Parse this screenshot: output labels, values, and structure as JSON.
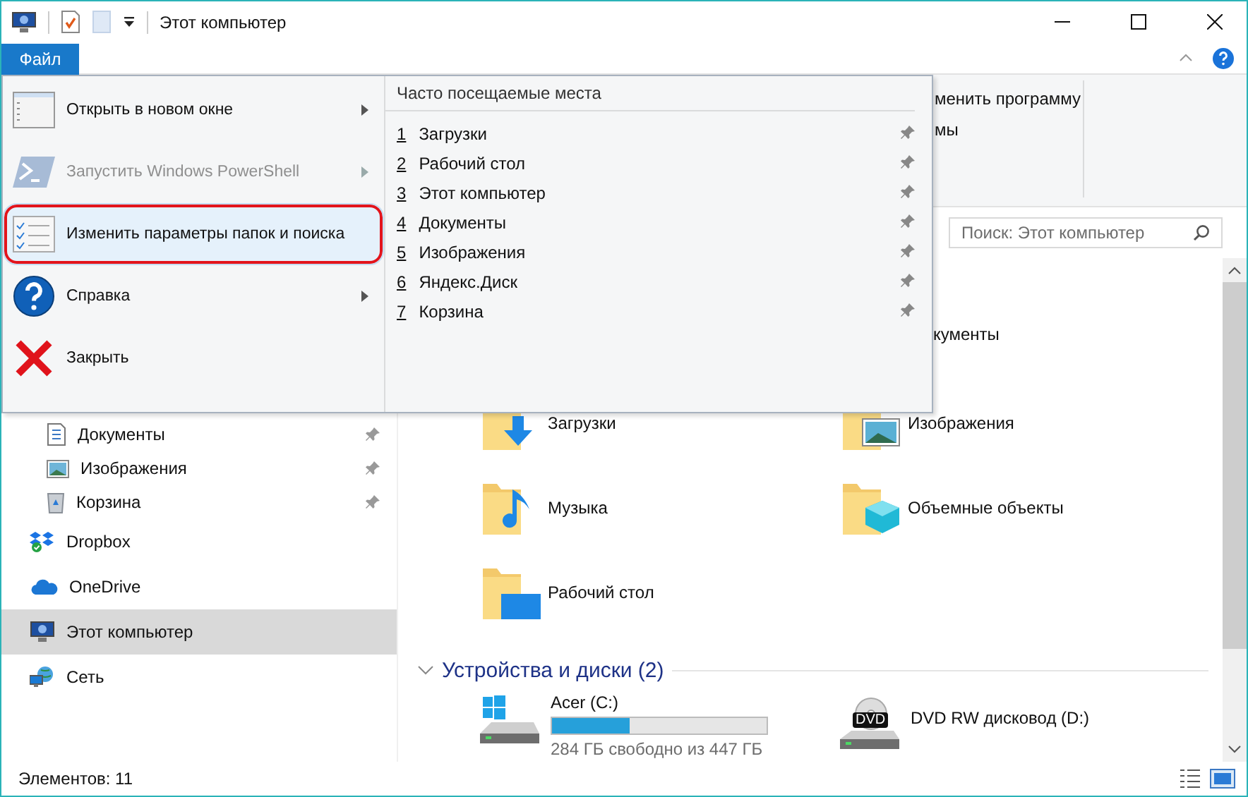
{
  "window": {
    "title": "Этот компьютер"
  },
  "file_tab": {
    "label": "Файл"
  },
  "file_menu": {
    "items": [
      {
        "label": "Открыть в новом окне",
        "kind": "window",
        "disabled": false,
        "submenu": true,
        "highlighted": false
      },
      {
        "label": "Запустить Windows PowerShell",
        "kind": "powershell",
        "disabled": true,
        "submenu": true,
        "highlighted": false
      },
      {
        "label": "Изменить параметры папок и поиска",
        "kind": "options",
        "disabled": false,
        "submenu": false,
        "highlighted": true
      },
      {
        "label": "Справка",
        "kind": "help",
        "disabled": false,
        "submenu": true,
        "highlighted": false
      },
      {
        "label": "Закрыть",
        "kind": "close",
        "disabled": false,
        "submenu": false,
        "highlighted": false
      }
    ]
  },
  "recent_places": {
    "title": "Часто посещаемые места",
    "items": [
      {
        "number": "1",
        "label": "Загрузки",
        "pinned": true
      },
      {
        "number": "2",
        "label": "Рабочий стол",
        "pinned": true
      },
      {
        "number": "3",
        "label": "Этот компьютер",
        "pinned": true
      },
      {
        "number": "4",
        "label": "Документы",
        "pinned": true
      },
      {
        "number": "5",
        "label": "Изображения",
        "pinned": true
      },
      {
        "number": "6",
        "label": "Яндекс.Диск",
        "pinned": true
      },
      {
        "number": "7",
        "label": "Корзина",
        "pinned": true
      }
    ]
  },
  "ribbon": {
    "fragments": [
      "менить программу",
      "мы"
    ]
  },
  "search": {
    "placeholder": "Поиск: Этот компьютер"
  },
  "sidebar": {
    "quick_access": [
      {
        "label": "Документы",
        "kind": "documents",
        "pinned": true
      },
      {
        "label": "Изображения",
        "kind": "pictures",
        "pinned": true
      },
      {
        "label": "Корзина",
        "kind": "recycle",
        "pinned": true
      }
    ],
    "items": [
      {
        "label": "Dropbox",
        "kind": "dropbox",
        "selected": false
      },
      {
        "label": "OneDrive",
        "kind": "onedrive",
        "selected": false
      },
      {
        "label": "Этот компьютер",
        "kind": "computer",
        "selected": true
      },
      {
        "label": "Сеть",
        "kind": "network",
        "selected": false
      }
    ]
  },
  "folders": [
    {
      "label": "кументы",
      "kind": "covered"
    },
    {
      "label": "Загрузки",
      "kind": "downloads"
    },
    {
      "label": "Изображения",
      "kind": "pictures"
    },
    {
      "label": "Музыка",
      "kind": "music"
    },
    {
      "label": "Объемные объекты",
      "kind": "objects"
    },
    {
      "label": "Рабочий стол",
      "kind": "desktop"
    }
  ],
  "devices": {
    "heading": "Устройства и диски (2)",
    "items": [
      {
        "label": "Acer (C:)",
        "kind": "disk",
        "level": 0.36,
        "caption": "284 ГБ свободно из 447 ГБ"
      },
      {
        "label": "DVD RW дисковод (D:)",
        "kind": "dvd",
        "badge": "DVD"
      }
    ]
  },
  "status_bar": {
    "text": "Элементов: 11"
  }
}
